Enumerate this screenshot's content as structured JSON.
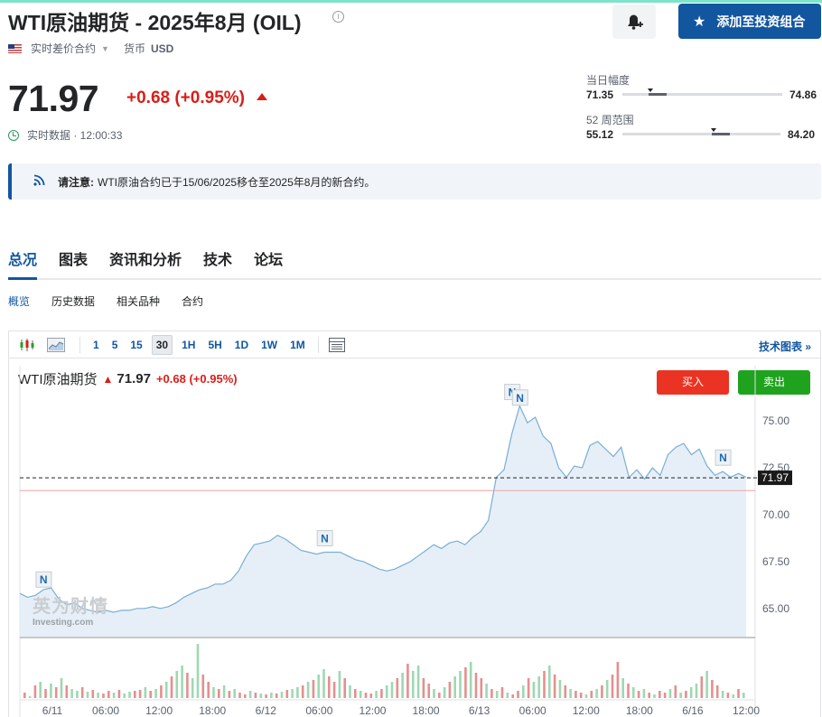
{
  "header": {
    "title": "WTI原油期货 - 2025年8月 (OIL)",
    "add_portfolio_label": "添加至投资组合",
    "contract_type": "实时差价合约",
    "currency_label": "货币",
    "currency": "USD"
  },
  "quote": {
    "price": "71.97",
    "change": "+0.68",
    "change_pct": "(+0.95%)",
    "realtime_label": "实时数据 · 12:00:33"
  },
  "day_range": {
    "label": "当日幅度",
    "low": "71.35",
    "high": "74.86",
    "current": 71.97
  },
  "week52_range": {
    "label": "52 周范围",
    "low": "55.12",
    "high": "84.20",
    "current": 71.97
  },
  "notice": {
    "label": "请注意:",
    "text": "WTI原油合约已于15/06/2025移仓至2025年8月的新合约。"
  },
  "tabs": [
    {
      "label": "总况",
      "active": true
    },
    {
      "label": "图表",
      "active": false
    },
    {
      "label": "资讯和分析",
      "active": false
    },
    {
      "label": "技术",
      "active": false
    },
    {
      "label": "论坛",
      "active": false
    }
  ],
  "subtabs": [
    {
      "label": "概览",
      "active": true
    },
    {
      "label": "历史数据",
      "active": false
    },
    {
      "label": "相关品种",
      "active": false
    },
    {
      "label": "合约",
      "active": false
    }
  ],
  "chart_toolbar": {
    "timeframes": [
      "1",
      "5",
      "15",
      "30",
      "1H",
      "5H",
      "1D",
      "1W",
      "1M"
    ],
    "active_timeframe": "30",
    "tech_chart_link": "技术图表 »"
  },
  "chart_header": {
    "name": "WTI原油期货",
    "price": "71.97",
    "change": "+0.68",
    "change_pct": "(+0.95%)",
    "buy_label": "买入",
    "sell_label": "卖出"
  },
  "watermark": {
    "cn": "英为财情",
    "en": "Investing.com"
  },
  "colors": {
    "brand_blue": "#1256a0",
    "up_red": "#d91e18",
    "buy_red": "#ea3323",
    "sell_green": "#1fa31f",
    "line": "#7aaed3",
    "area": "#e3edf6"
  },
  "chart_data": {
    "type": "area",
    "ylim": [
      63.5,
      76.5
    ],
    "y_ticks": [
      65.0,
      67.5,
      70.0,
      72.5,
      75.0
    ],
    "y_tick_labels": [
      "65.00",
      "67.50",
      "70.00",
      "72.50",
      "75.00"
    ],
    "x_tick_labels": [
      "6/11",
      "06:00",
      "12:00",
      "18:00",
      "6/12",
      "06:00",
      "12:00",
      "18:00",
      "6/13",
      "06:00",
      "12:00",
      "18:00",
      "6/16",
      "12:00"
    ],
    "current_price": 71.97,
    "current_price_label": "71.97",
    "prev_close": 71.29,
    "news_marker_label": "N",
    "values": [
      65.8,
      65.6,
      65.7,
      66.0,
      66.1,
      65.5,
      65.2,
      65.3,
      65.0,
      64.9,
      64.8,
      64.9,
      64.8,
      64.9,
      64.9,
      65.0,
      65.0,
      65.1,
      65.0,
      65.1,
      65.3,
      65.6,
      65.8,
      66.0,
      66.1,
      66.3,
      66.3,
      66.5,
      67.0,
      67.8,
      68.4,
      68.5,
      68.6,
      68.9,
      68.7,
      68.4,
      68.1,
      68.0,
      67.9,
      68.0,
      68.0,
      68.0,
      67.8,
      67.6,
      67.5,
      67.3,
      67.1,
      67.0,
      67.1,
      67.3,
      67.5,
      67.8,
      68.1,
      68.4,
      68.2,
      68.5,
      68.6,
      68.4,
      68.8,
      69.1,
      69.7,
      72.0,
      72.4,
      74.3,
      75.8,
      74.9,
      75.2,
      74.2,
      73.8,
      72.5,
      72.0,
      72.6,
      72.5,
      73.7,
      73.9,
      73.5,
      73.1,
      73.6,
      72.0,
      72.4,
      71.9,
      72.5,
      72.1,
      73.2,
      73.6,
      73.8,
      73.2,
      73.5,
      72.6,
      72.1,
      72.3,
      72.0,
      72.2,
      72.0
    ],
    "news_markers": [
      {
        "index": 3,
        "value": 65.8
      },
      {
        "index": 39,
        "value": 68.0
      },
      {
        "index": 63,
        "value": 75.8
      },
      {
        "index": 64,
        "value": 75.5
      },
      {
        "index": 90,
        "value": 72.3
      }
    ],
    "volume": [
      6,
      2,
      14,
      18,
      10,
      16,
      12,
      22,
      14,
      10,
      8,
      12,
      7,
      9,
      6,
      5,
      8,
      6,
      9,
      5,
      7,
      8,
      9,
      12,
      8,
      10,
      14,
      18,
      24,
      30,
      36,
      28,
      22,
      60,
      26,
      18,
      12,
      10,
      14,
      8,
      10,
      6,
      4,
      8,
      6,
      5,
      4,
      6,
      5,
      7,
      9,
      10,
      12,
      14,
      18,
      20,
      26,
      32,
      24,
      18,
      30,
      22,
      14,
      10,
      8,
      6,
      5,
      8,
      10,
      14,
      18,
      22,
      28,
      38,
      30,
      36,
      22,
      16,
      10,
      6,
      12,
      18,
      24,
      30,
      34,
      40,
      28,
      22,
      16,
      10,
      8,
      12,
      6,
      4,
      8,
      14,
      22,
      18,
      24,
      30,
      36,
      26,
      20,
      14,
      10,
      8,
      6,
      4,
      8,
      10,
      14,
      20,
      26,
      40,
      22,
      16,
      12,
      8,
      10,
      6,
      4,
      8,
      6,
      10,
      14,
      6,
      8,
      12,
      16,
      24,
      30,
      20,
      14,
      8,
      6,
      4,
      10,
      6
    ],
    "volume_up": [
      false,
      true,
      false,
      true,
      false,
      true,
      false,
      true,
      false,
      true,
      true,
      false,
      true,
      false,
      true,
      false,
      false,
      true,
      false,
      true,
      true,
      false,
      false,
      true,
      false,
      true,
      false,
      true,
      false,
      true,
      true,
      false,
      true,
      true,
      false,
      false,
      true,
      false,
      true,
      false,
      true,
      false,
      false,
      true,
      false,
      true,
      false,
      true,
      false,
      true,
      false,
      true,
      true,
      false,
      true,
      false,
      true,
      true,
      false,
      false,
      true,
      false,
      true,
      false,
      true,
      false,
      false,
      true,
      false,
      true,
      true,
      false,
      true,
      false,
      true,
      true,
      false,
      false,
      true,
      false,
      true,
      false,
      true,
      true,
      false,
      true,
      false,
      false,
      true,
      false,
      true,
      false,
      true,
      false,
      false,
      true,
      false,
      true,
      true,
      false,
      true,
      false,
      true,
      false,
      true,
      false,
      false,
      true,
      false,
      true,
      false,
      true,
      false,
      false,
      true,
      false,
      true,
      false,
      true,
      false,
      true,
      false,
      false,
      true,
      false,
      true,
      false,
      true,
      true,
      false,
      true,
      false,
      false,
      true,
      false,
      true,
      false,
      true,
      false
    ]
  }
}
